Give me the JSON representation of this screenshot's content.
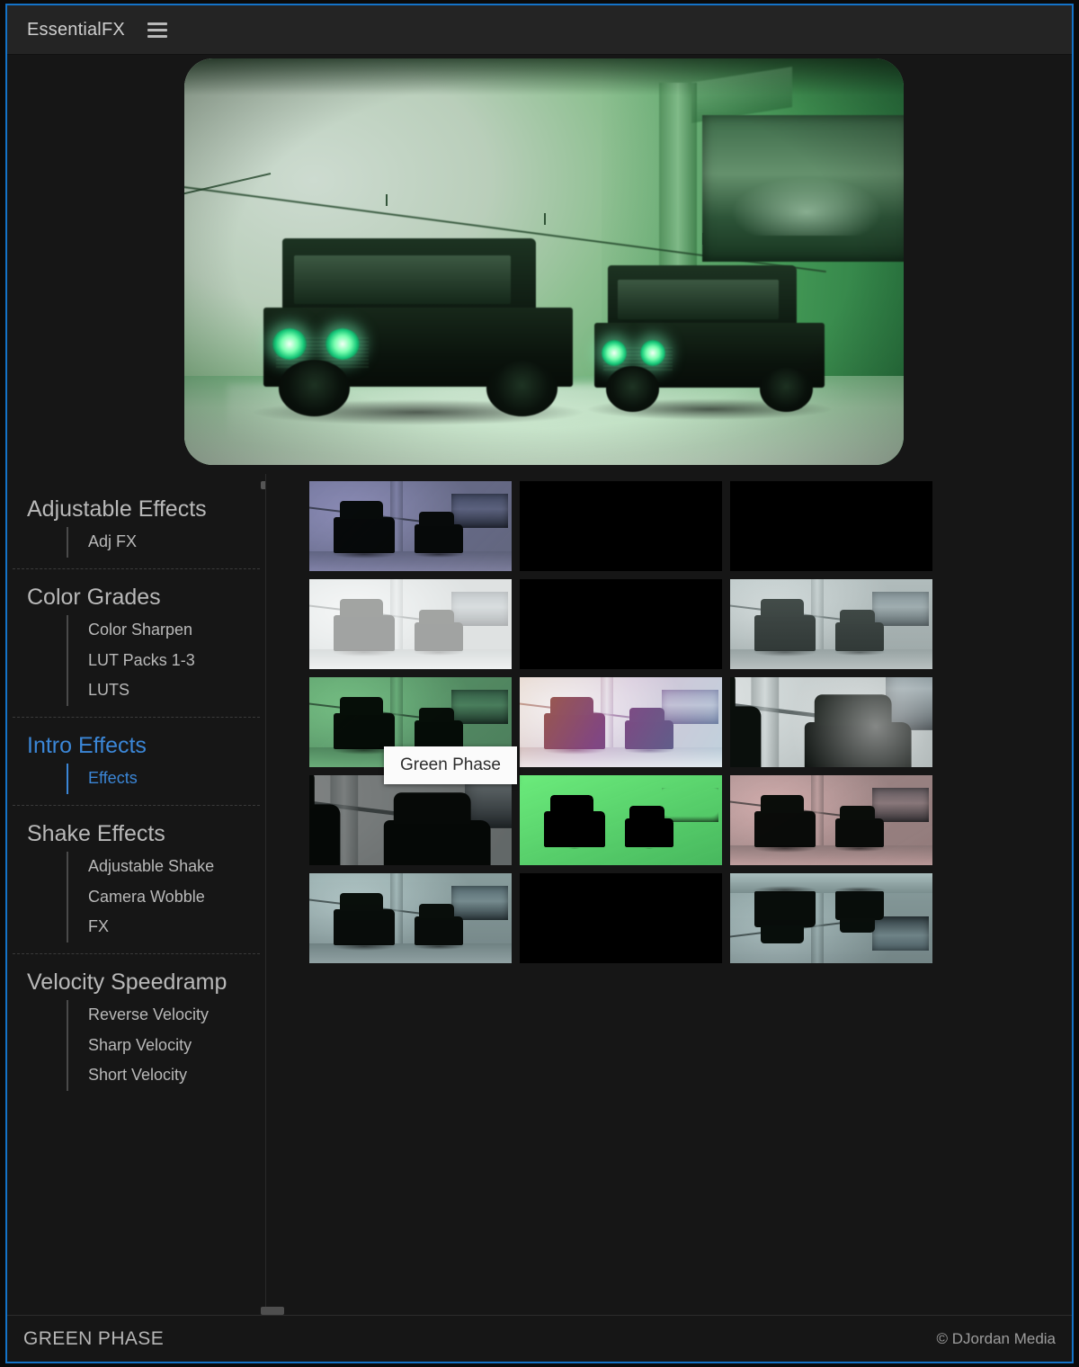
{
  "window": {
    "title": "EssentialFX",
    "menu_icon": "hamburger-icon",
    "accent_color": "#1473c8",
    "border_color": "#1473c8"
  },
  "preview": {
    "name": "Green Phase",
    "grade": "green",
    "subject": "two black Mercedes G-Wagons in a studio"
  },
  "sidebar": {
    "groups": [
      {
        "label": "Adjustable Effects",
        "active": false,
        "items": [
          {
            "label": "Adj FX",
            "active": false
          }
        ]
      },
      {
        "label": "Color Grades",
        "active": false,
        "items": [
          {
            "label": "Color Sharpen",
            "active": false
          },
          {
            "label": "LUT Packs 1-3",
            "active": false
          },
          {
            "label": "LUTS",
            "active": false
          }
        ]
      },
      {
        "label": "Intro Effects",
        "active": true,
        "items": [
          {
            "label": "Effects",
            "active": true
          }
        ]
      },
      {
        "label": "Shake Effects",
        "active": false,
        "items": [
          {
            "label": "Adjustable Shake",
            "active": false
          },
          {
            "label": "Camera Wobble",
            "active": false
          },
          {
            "label": "FX",
            "active": false
          }
        ]
      },
      {
        "label": "Velocity Speedramp",
        "active": false,
        "items": [
          {
            "label": "Reverse Velocity",
            "active": false
          },
          {
            "label": "Sharp Velocity",
            "active": false
          },
          {
            "label": "Short Velocity",
            "active": false
          }
        ]
      }
    ]
  },
  "grid": {
    "columns": 3,
    "rows": 5,
    "tooltip": "Green Phase",
    "thumbnails": [
      {
        "grade": "purple",
        "variant": "plain"
      },
      {
        "grade": "letterbox-a",
        "variant": "lb"
      },
      {
        "grade": "letterbox-b",
        "variant": "lb2"
      },
      {
        "grade": "bright",
        "variant": "plain"
      },
      {
        "grade": "edge",
        "variant": "edge"
      },
      {
        "grade": "soft",
        "variant": "plain"
      },
      {
        "grade": "green",
        "variant": "plain"
      },
      {
        "grade": "psych",
        "variant": "plain"
      },
      {
        "grade": "zoom",
        "variant": "zoomed"
      },
      {
        "grade": "dark",
        "variant": "zoomed"
      },
      {
        "grade": "neon",
        "variant": "edge2"
      },
      {
        "grade": "red",
        "variant": "plain"
      },
      {
        "grade": "teal",
        "variant": "plain"
      },
      {
        "grade": "warp",
        "variant": "warp"
      },
      {
        "grade": "teal",
        "variant": "mirror"
      }
    ]
  },
  "status": {
    "left": "GREEN PHASE",
    "right": "© DJordan Media"
  }
}
